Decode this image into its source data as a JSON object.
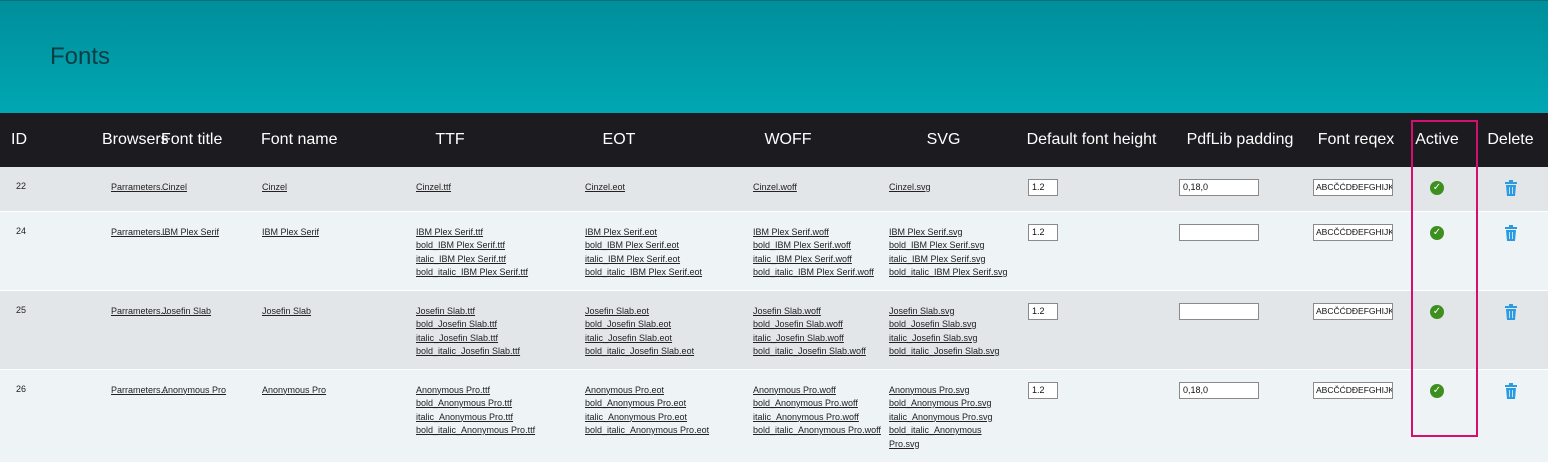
{
  "page": {
    "title": "Fonts"
  },
  "columns": {
    "id": "ID",
    "browsers": "Browsers",
    "font_title": "Font title",
    "font_name": "Font name",
    "ttf": "TTF",
    "eot": "EOT",
    "woff": "WOFF",
    "svg": "SVG",
    "default_font_height": "Default font height",
    "pdflib_padding": "PdfLib padding",
    "font_regex": "Font reqex",
    "active": "Active",
    "delete": "Delete"
  },
  "rows": [
    {
      "id": "22",
      "browsers": "Parrameters...",
      "font_title": "Cinzel",
      "font_name": "Cinzel",
      "ttf": [
        "Cinzel.ttf"
      ],
      "eot": [
        "Cinzel.eot"
      ],
      "woff": [
        "Cinzel.woff"
      ],
      "svg": [
        "Cinzel.svg"
      ],
      "height": "1.2",
      "padding": "0,18,0",
      "regex": "ABCČĆDĐEFGHIJK",
      "active_icon": "check-circle-icon",
      "delete_icon": "trash-icon"
    },
    {
      "id": "24",
      "browsers": "Parrameters...",
      "font_title": "IBM Plex Serif",
      "font_name": "IBM Plex Serif",
      "ttf": [
        "IBM Plex Serif.ttf",
        "bold_IBM Plex Serif.ttf",
        "italic_IBM Plex Serif.ttf",
        "bold_italic_IBM Plex Serif.ttf"
      ],
      "eot": [
        "IBM Plex Serif.eot",
        "bold_IBM Plex Serif.eot",
        "italic_IBM Plex Serif.eot",
        "bold_italic_IBM Plex Serif.eot"
      ],
      "woff": [
        "IBM Plex Serif.woff",
        "bold_IBM Plex Serif.woff",
        "italic_IBM Plex Serif.woff",
        "bold_italic_IBM Plex Serif.woff"
      ],
      "svg": [
        "IBM Plex Serif.svg",
        "bold_IBM Plex Serif.svg",
        "italic_IBM Plex Serif.svg",
        "bold_italic_IBM Plex Serif.svg"
      ],
      "height": "1.2",
      "padding": "",
      "regex": "ABCČĆDĐEFGHIJK",
      "active_icon": "check-circle-icon",
      "delete_icon": "trash-icon"
    },
    {
      "id": "25",
      "browsers": "Parrameters...",
      "font_title": "Josefin Slab",
      "font_name": "Josefin Slab",
      "ttf": [
        "Josefin Slab.ttf",
        "bold_Josefin Slab.ttf",
        "italic_Josefin Slab.ttf",
        "bold_italic_Josefin Slab.ttf"
      ],
      "eot": [
        "Josefin Slab.eot",
        "bold_Josefin Slab.eot",
        "italic_Josefin Slab.eot",
        "bold_italic_Josefin Slab.eot"
      ],
      "woff": [
        "Josefin Slab.woff",
        "bold_Josefin Slab.woff",
        "italic_Josefin Slab.woff",
        "bold_italic_Josefin Slab.woff"
      ],
      "svg": [
        "Josefin Slab.svg",
        "bold_Josefin Slab.svg",
        "italic_Josefin Slab.svg",
        "bold_italic_Josefin Slab.svg"
      ],
      "height": "1.2",
      "padding": "",
      "regex": "ABCČĆDĐEFGHIJK",
      "active_icon": "check-circle-icon",
      "delete_icon": "trash-icon"
    },
    {
      "id": "26",
      "browsers": "Parrameters...",
      "font_title": "Anonymous Pro",
      "font_name": "Anonymous Pro",
      "ttf": [
        "Anonymous Pro.ttf",
        "bold_Anonymous Pro.ttf",
        "italic_Anonymous Pro.ttf",
        "bold_italic_Anonymous Pro.ttf"
      ],
      "eot": [
        "Anonymous Pro.eot",
        "bold_Anonymous Pro.eot",
        "italic_Anonymous Pro.eot",
        "bold_italic_Anonymous Pro.eot"
      ],
      "woff": [
        "Anonymous Pro.woff",
        "bold_Anonymous Pro.woff",
        "italic_Anonymous Pro.woff",
        "bold_italic_Anonymous Pro.woff"
      ],
      "svg": [
        "Anonymous Pro.svg",
        "bold_Anonymous Pro.svg",
        "italic_Anonymous Pro.svg",
        "bold_italic_Anonymous",
        "Pro.svg"
      ],
      "height": "1.2",
      "padding": "0,18,0",
      "regex": "ABCČĆDĐEFGHIJK",
      "active_icon": "check-circle-icon",
      "delete_icon": "trash-icon"
    }
  ],
  "colors": {
    "header_gradient_top": "#008e9b",
    "header_gradient_bottom": "#00a7b3",
    "table_header_bg": "#1c1b20",
    "row_a": "#e3e6e9",
    "row_b": "#eef3f6",
    "active_green": "#3d8f1e",
    "delete_blue": "#2a9be0",
    "highlight_border": "#d4106e"
  }
}
